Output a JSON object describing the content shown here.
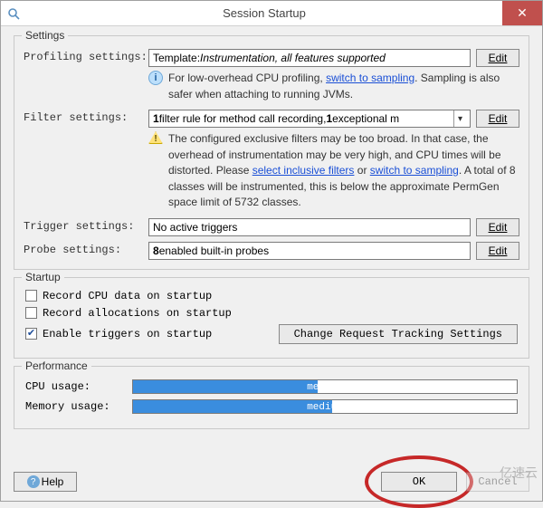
{
  "window": {
    "title": "Session Startup"
  },
  "settings_group": {
    "legend": "Settings",
    "profiling": {
      "label": "Profiling settings:",
      "prefix": "Template: ",
      "value": "Instrumentation, all features supported",
      "edit": "Edit",
      "info_text_1": "For low-overhead CPU profiling, ",
      "link_1": "switch to sampling",
      "info_text_2": ". Sampling is also safer when attaching to running JVMs."
    },
    "filter": {
      "label": "Filter settings:",
      "value_1": "1",
      "value_2": " filter rule for method call recording, ",
      "value_3": "1",
      "value_4": " exceptional m",
      "edit": "Edit",
      "warn_1": "The configured exclusive filters may be too broad. In that case, the overhead of instrumentation may be very high, and CPU times will be distorted. Please ",
      "link_1": "select inclusive filters",
      "warn_2": " or ",
      "link_2": "switch to sampling",
      "warn_3": ". A total of 8 classes will be instrumented, this is below the approximate PermGen space limit of 5732 classes."
    },
    "trigger": {
      "label": "Trigger settings:",
      "value": "No active triggers",
      "edit": "Edit"
    },
    "probe": {
      "label": "Probe settings:",
      "value_1": "8",
      "value_2": " enabled built-in probes",
      "edit": "Edit"
    }
  },
  "startup_group": {
    "legend": "Startup",
    "record_cpu": {
      "label": "Record CPU data on startup",
      "checked": false
    },
    "record_alloc": {
      "label": "Record allocations on startup",
      "checked": false
    },
    "enable_triggers": {
      "label": "Enable triggers on startup",
      "checked": true
    },
    "change_btn": "Change Request Tracking Settings"
  },
  "perf_group": {
    "legend": "Performance",
    "cpu": {
      "label": "CPU usage:",
      "level": "medium",
      "pct": 48
    },
    "memory": {
      "label": "Memory usage:",
      "level": "medium",
      "pct": 52
    }
  },
  "footer": {
    "help": "Help",
    "ok": "OK",
    "cancel": "Cancel"
  },
  "watermark": "亿速云"
}
